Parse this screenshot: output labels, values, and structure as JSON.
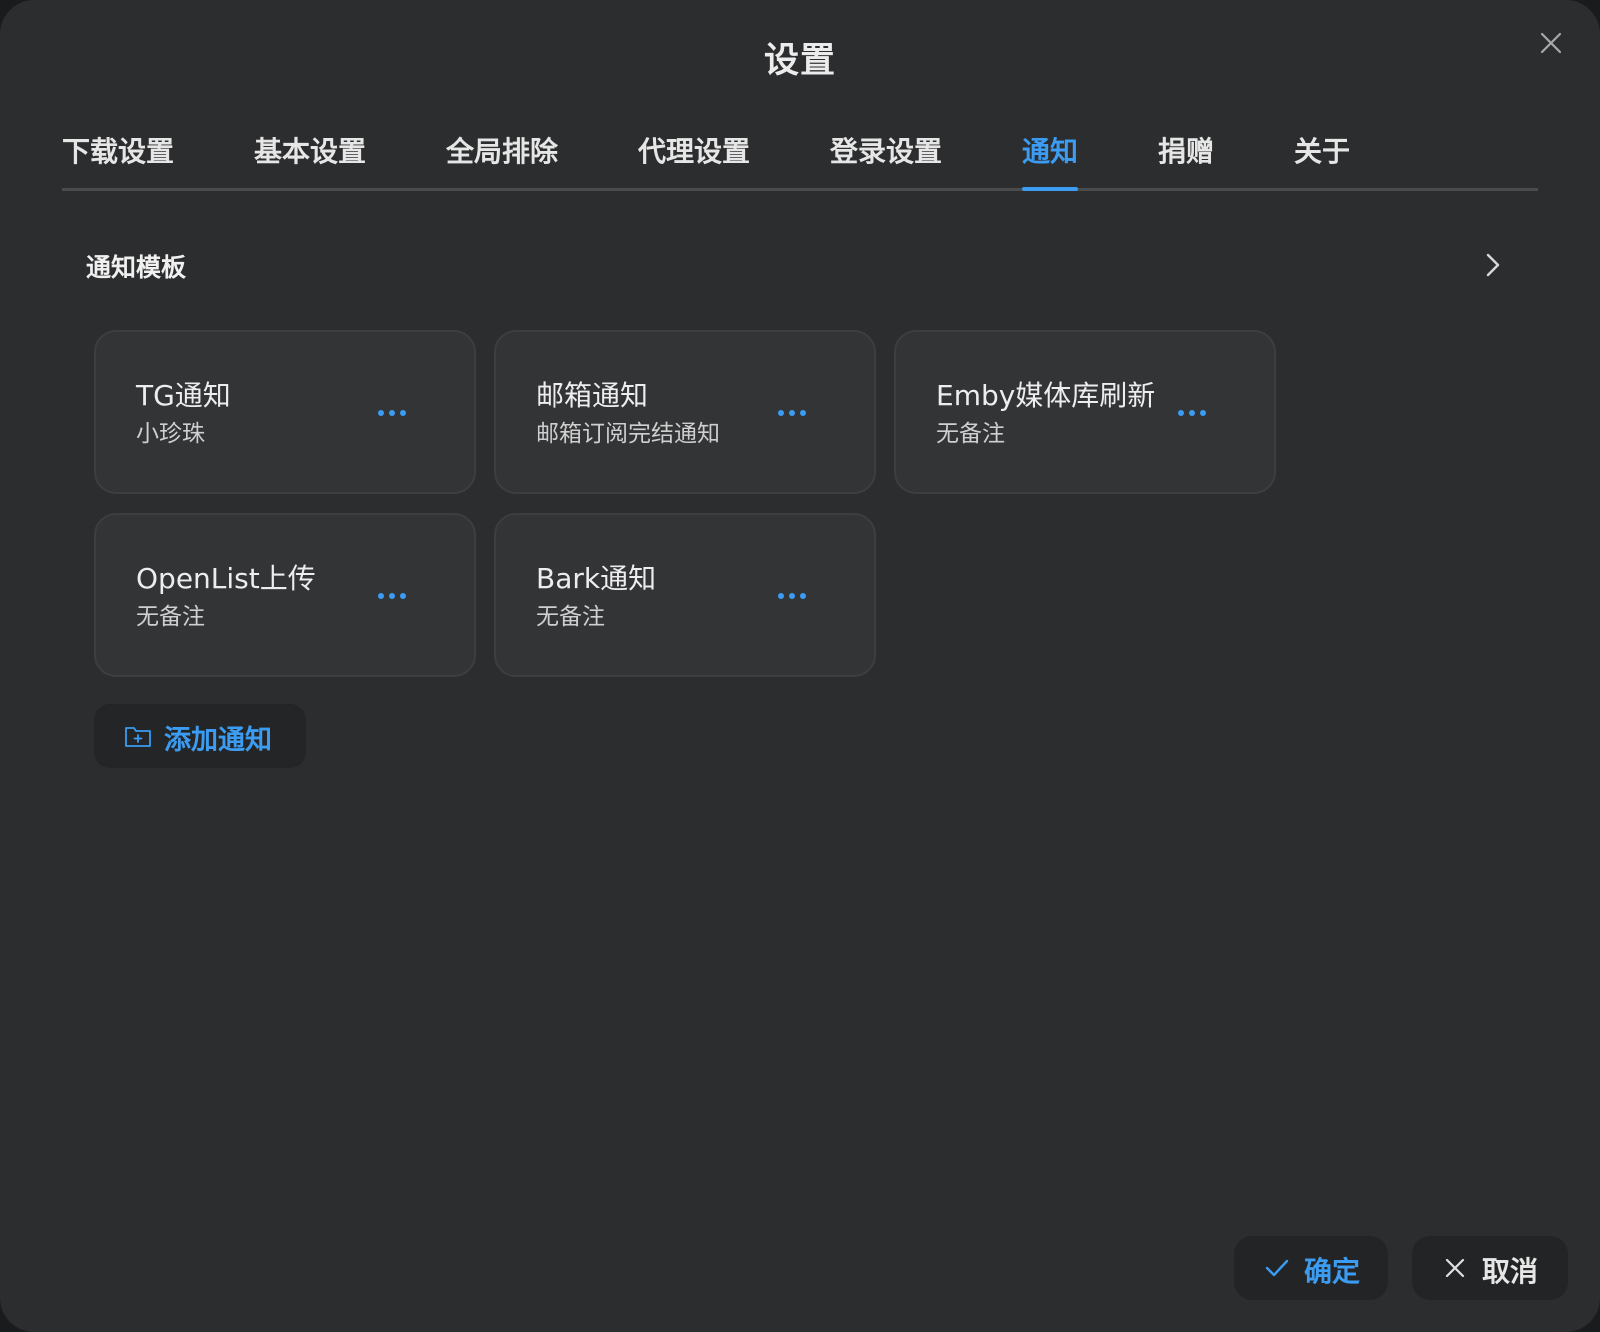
{
  "dialog": {
    "title": "设置",
    "close_icon": "close-icon"
  },
  "tabs": [
    {
      "label": "下载设置",
      "active": false
    },
    {
      "label": "基本设置",
      "active": false
    },
    {
      "label": "全局排除",
      "active": false
    },
    {
      "label": "代理设置",
      "active": false
    },
    {
      "label": "登录设置",
      "active": false
    },
    {
      "label": "通知",
      "active": true
    },
    {
      "label": "捐赠",
      "active": false
    },
    {
      "label": "关于",
      "active": false
    }
  ],
  "section": {
    "title": "通知模板",
    "icon": "chevron-right-icon"
  },
  "notifications": [
    {
      "title": "TG通知",
      "subtitle": "小珍珠"
    },
    {
      "title": "邮箱通知",
      "subtitle": "邮箱订阅完结通知"
    },
    {
      "title": "Emby媒体库刷新",
      "subtitle": "无备注"
    },
    {
      "title": "OpenList上传",
      "subtitle": "无备注"
    },
    {
      "title": "Bark通知",
      "subtitle": "无备注"
    }
  ],
  "add_button": {
    "label": "添加通知",
    "icon": "folder-plus-icon"
  },
  "footer": {
    "confirm_label": "确定",
    "confirm_icon": "check-icon",
    "cancel_label": "取消",
    "cancel_icon": "close-icon"
  },
  "colors": {
    "accent": "#3b9cf2",
    "background": "#2c2d2e",
    "card": "#333436"
  }
}
